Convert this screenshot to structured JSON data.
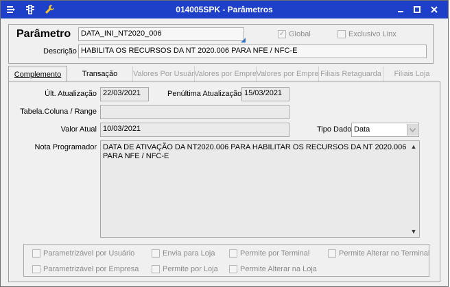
{
  "window": {
    "title": "014005SPK - Parâmetros",
    "colors": {
      "titlebar": "#1e40c8"
    }
  },
  "header": {
    "parametro_label": "Parâmetro",
    "parametro_value": "DATA_INI_NT2020_006",
    "descricao_label": "Descrição",
    "descricao_value": "HABILITA OS RECURSOS DA NT 2020.006 PARA NFE / NFC-E",
    "global_label": "Global",
    "global_checked": true,
    "exclusivo_label": "Exclusivo Linx",
    "exclusivo_checked": false
  },
  "tabs": [
    {
      "label": "Complemento",
      "state": "active"
    },
    {
      "label": "Transação",
      "state": "enabled"
    },
    {
      "label": "Valores Por Usuár",
      "state": "disabled"
    },
    {
      "label": "Valores por Empre",
      "state": "disabled"
    },
    {
      "label": "Valores por Empre",
      "state": "disabled"
    },
    {
      "label": "Filiais Retaguarda",
      "state": "disabled"
    },
    {
      "label": "Filiais Loja",
      "state": "disabled"
    }
  ],
  "form": {
    "ult_atualizacao_label": "Últ. Atualização",
    "ult_atualizacao_value": "22/03/2021",
    "penultima_label": "Penúltima Atualização",
    "penultima_value": "15/03/2021",
    "tabela_label": "Tabela.Coluna / Range",
    "tabela_value": "",
    "valor_atual_label": "Valor Atual",
    "valor_atual_value": "10/03/2021",
    "tipo_dado_label": "Tipo Dado",
    "tipo_dado_value": "Data",
    "nota_label": "Nota Programador",
    "nota_value": "DATA DE ATIVAÇÃO DA NT2020.006 PARA HABILITAR OS RECURSOS DA NT 2020.006\nPARA NFE / NFC-E"
  },
  "options": {
    "parametrizavel_usuario": "Parametrizável por Usuário",
    "envia_loja": "Envia para Loja",
    "permite_terminal": "Permite por Terminal",
    "permite_alterar_terminal": "Permite Alterar no Terminal",
    "parametrizavel_empresa": "Parametrizável por Empresa",
    "permite_loja": "Permite por Loja",
    "permite_alterar_loja": "Permite Alterar na Loja"
  }
}
